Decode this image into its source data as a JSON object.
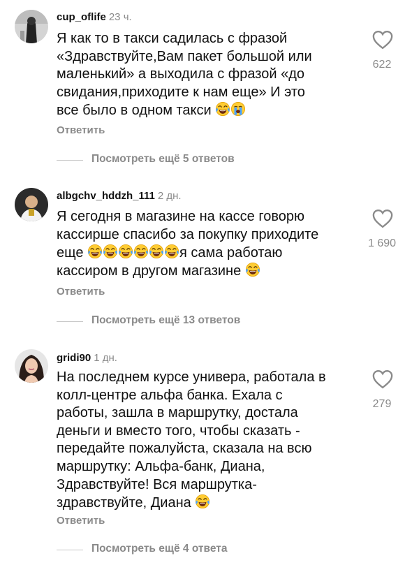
{
  "comments": [
    {
      "username": "cup_oflife",
      "time": "23 ч.",
      "lines": [
        "Я как то в такси садилась с фразой",
        "«Здравствуйте,Вам пакет большой или",
        "маленький» а выходила с фразой «до",
        "свидания,приходите к нам еще» И это",
        "все было в одном такси"
      ],
      "likes": "622",
      "reply_label": "Ответить",
      "view_replies": "Посмотреть ещё 5 ответов"
    },
    {
      "username": "albgchv_hddzh_111",
      "time": "2 дн.",
      "lines": [
        "Я сегодня в магазине на кассе говорю",
        "кассирше спасибо за покупку приходите",
        "еще",
        "я сама работаю",
        "кассиром в другом магазине"
      ],
      "likes": "1 690",
      "reply_label": "Ответить",
      "view_replies": "Посмотреть ещё 13 ответов"
    },
    {
      "username": "gridi90",
      "time": "1 дн.",
      "lines": [
        "На последнем курсе универа, работала в",
        "колл-центре альфа банка. Ехала с",
        "работы, зашла в маршрутку, достала",
        "деньги и вместо того, чтобы сказать -",
        "передайте пожалуйста, сказала на всю",
        "маршрутку: Альфа-банк, Диана,",
        "Здравствуйте!  Вся маршрутка-",
        "здравствуйте, Диана"
      ],
      "likes": "279",
      "reply_label": "Ответить",
      "view_replies": "Посмотреть ещё 4 ответа"
    }
  ],
  "icons": {
    "like": "heart-outline-icon",
    "laugh": "face-with-tears-of-joy-emoji",
    "cry": "loudly-crying-face-emoji"
  }
}
